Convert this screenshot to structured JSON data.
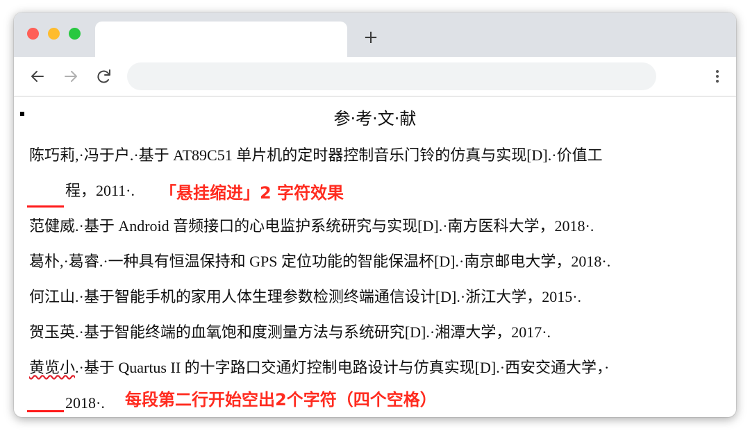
{
  "browser": {
    "new_tab_label": "+"
  },
  "document": {
    "title": "参·考·文·献",
    "references": [
      {
        "line1": "陈巧莉,·冯于户.·基于 AT89C51 单片机的定时器控制音乐门铃的仿真与实现[D].·价值工",
        "line2": "程，2011·."
      },
      {
        "line1": "范健威.·基于 Android 音频接口的心电监护系统研究与实现[D].·南方医科大学，2018·."
      },
      {
        "line1": "葛朴,·葛睿.·一种具有恒温保持和 GPS 定位功能的智能保温杯[D].·南京邮电大学，2018·."
      },
      {
        "line1": "何江山.·基于智能手机的家用人体生理参数检测终端通信设计[D].·浙江大学，2015·."
      },
      {
        "line1": "贺玉英.·基于智能终端的血氧饱和度测量方法与系统研究[D].·湘潭大学，2017·."
      },
      {
        "author": "黄览小",
        "line1_rest": ".·基于 Quartus II 的十字路口交通灯控制电路设计与仿真实现[D].·西安交通大学，·",
        "line2": "2018·."
      }
    ],
    "annotations": {
      "hanging_indent": "「悬挂缩进」2 字符效果",
      "second_line": "每段第二行开始空出2个字符（四个空格）"
    }
  }
}
